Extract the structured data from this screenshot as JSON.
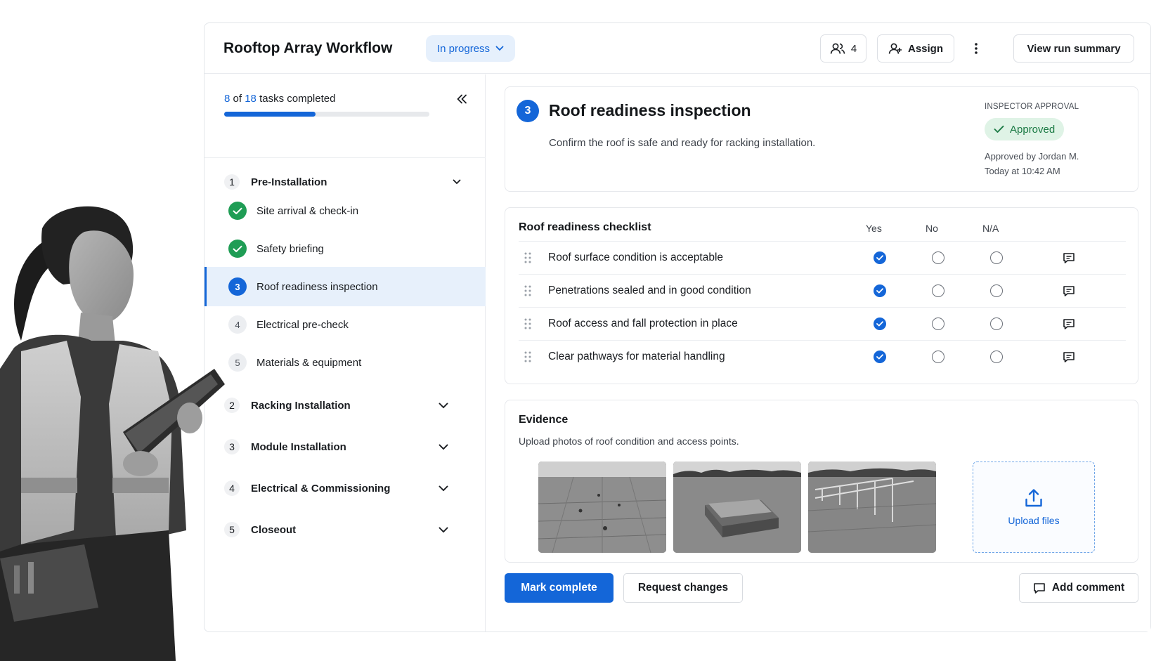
{
  "header": {
    "title": "Rooftop Array Workflow",
    "status": "In progress",
    "assignee_count": "4",
    "assign_label": "Assign",
    "summary_label": "View run summary"
  },
  "sidebar": {
    "progress": {
      "completed": "8",
      "of_text": "of",
      "total": "18",
      "suffix": "tasks completed",
      "fraction": 0.444
    },
    "sections": [
      {
        "num": "1",
        "label": "Pre-Installation",
        "expanded": true,
        "tasks": [
          {
            "label": "Site arrival & check-in",
            "state": "done"
          },
          {
            "label": "Safety briefing",
            "state": "done"
          },
          {
            "num": "3",
            "label": "Roof readiness inspection",
            "state": "current"
          },
          {
            "num": "4",
            "label": "Electrical pre-check",
            "state": "pending"
          },
          {
            "num": "5",
            "label": "Materials & equipment",
            "state": "pending"
          }
        ]
      },
      {
        "num": "2",
        "label": "Racking Installation",
        "expanded": false
      },
      {
        "num": "3",
        "label": "Module Installation",
        "expanded": false
      },
      {
        "num": "4",
        "label": "Electrical & Commissioning",
        "expanded": false
      },
      {
        "num": "5",
        "label": "Closeout",
        "expanded": false
      }
    ]
  },
  "task": {
    "number": "3",
    "title": "Roof readiness inspection",
    "description": "Confirm the roof is safe and ready for racking installation.",
    "approval": {
      "label": "INSPECTOR APPROVAL",
      "status": "Approved",
      "by": "Approved by Jordan M.",
      "when": "Today at 10:42 AM"
    }
  },
  "checklist": {
    "title": "Roof readiness checklist",
    "columns": [
      "Yes",
      "No",
      "N/A"
    ],
    "items": [
      {
        "label": "Roof surface condition is acceptable",
        "answer": "Yes"
      },
      {
        "label": "Penetrations sealed and in good condition",
        "answer": "Yes"
      },
      {
        "label": "Roof access and fall protection in place",
        "answer": "Yes"
      },
      {
        "label": "Clear pathways for material handling",
        "answer": "Yes"
      }
    ]
  },
  "evidence": {
    "title": "Evidence",
    "description": "Upload photos of roof condition and access points.",
    "upload_label": "Upload files"
  },
  "actions": {
    "complete": "Mark complete",
    "request": "Request changes",
    "comment": "Add comment"
  },
  "colors": {
    "accent": "#1466d8",
    "success": "#1f9d55",
    "success_bg": "#dff3e6",
    "active_bg": "#e7f0fb"
  }
}
